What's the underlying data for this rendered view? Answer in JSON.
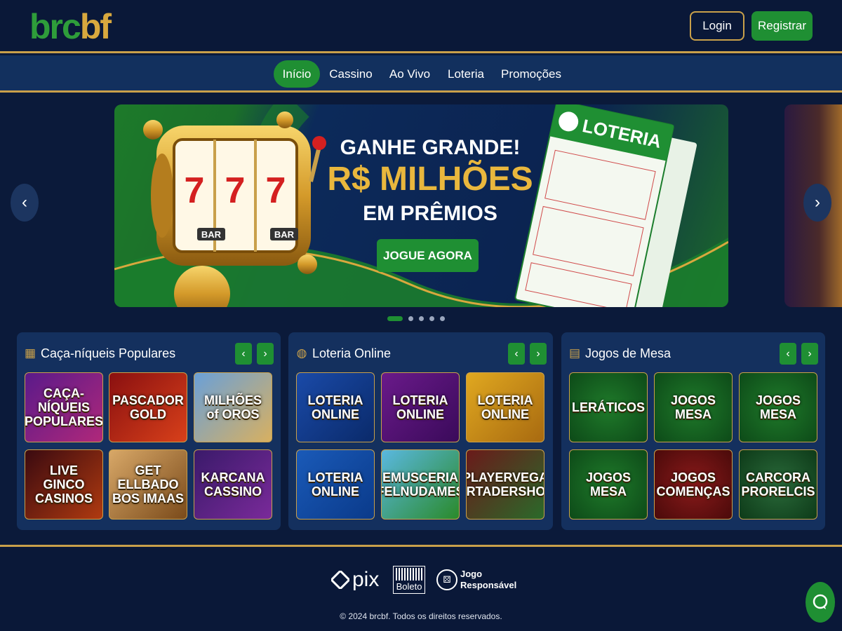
{
  "header": {
    "logo_part1": "brc",
    "logo_part2": "bf",
    "login_label": "Login",
    "register_label": "Registrar"
  },
  "nav": {
    "items": [
      {
        "label": "Início",
        "active": true
      },
      {
        "label": "Cassino",
        "active": false
      },
      {
        "label": "Ao Vivo",
        "active": false
      },
      {
        "label": "Loteria",
        "active": false
      },
      {
        "label": "Promoções",
        "active": false
      }
    ]
  },
  "banner": {
    "title": "GANHE GRANDE!",
    "big": "R$ MILHÕES",
    "sub": "EM PRÊMIOS",
    "cta": "JOGUE AGORA",
    "ticket_label": "LOTERIA",
    "slot_bar": "BAR",
    "slot_seven": "7",
    "slide_count": 5,
    "active_slide": 1
  },
  "panels": [
    {
      "title": "Caça-níqueis Populares",
      "icon": "slot-machine-icon",
      "tiles": [
        {
          "line1": "CAÇA-NÍQUEIS",
          "line2": "POPULARES"
        },
        {
          "line1": "PASCADOR",
          "line2": "GOLD"
        },
        {
          "line1": "MILHÕES",
          "line2": "of OROS"
        },
        {
          "line1": "LIVE GINCO",
          "line2": "CASINOS"
        },
        {
          "line1": "GET ELLBADO",
          "line2": "BOS IMAAS"
        },
        {
          "line1": "KARCANA",
          "line2": "CASSINO"
        }
      ]
    },
    {
      "title": "Loteria Online",
      "icon": "globe-icon",
      "tiles": [
        {
          "line1": "LOTERIA",
          "line2": "ONLINE"
        },
        {
          "line1": "LOTERIA",
          "line2": "ONLINE"
        },
        {
          "line1": "LOTERIA",
          "line2": "ONLINE"
        },
        {
          "line1": "LOTERIA",
          "line2": "ONLINE"
        },
        {
          "line1": "EMUSCERIA",
          "line2": "FELNUDAMES"
        },
        {
          "line1": "PLAYERVEGA",
          "line2": "CORTADERSHORP"
        }
      ]
    },
    {
      "title": "Jogos de Mesa",
      "icon": "cards-icon",
      "tiles": [
        {
          "line1": "LERÁTICOS",
          "line2": ""
        },
        {
          "line1": "JOGOS",
          "line2": "MESA"
        },
        {
          "line1": "JOGOS",
          "line2": "MESA"
        },
        {
          "line1": "JOGOS",
          "line2": "MESA"
        },
        {
          "line1": "JOGOS",
          "line2": "COMENÇAS"
        },
        {
          "line1": "CARCORA",
          "line2": "PRORELCIS"
        }
      ]
    }
  ],
  "footer": {
    "pix": "pix",
    "boleto": "Boleto",
    "jogo_responsavel_1": "Jogo",
    "jogo_responsavel_2": "Responsável",
    "copyright": "© 2024 brcbf. Todos os direitos reservados."
  }
}
